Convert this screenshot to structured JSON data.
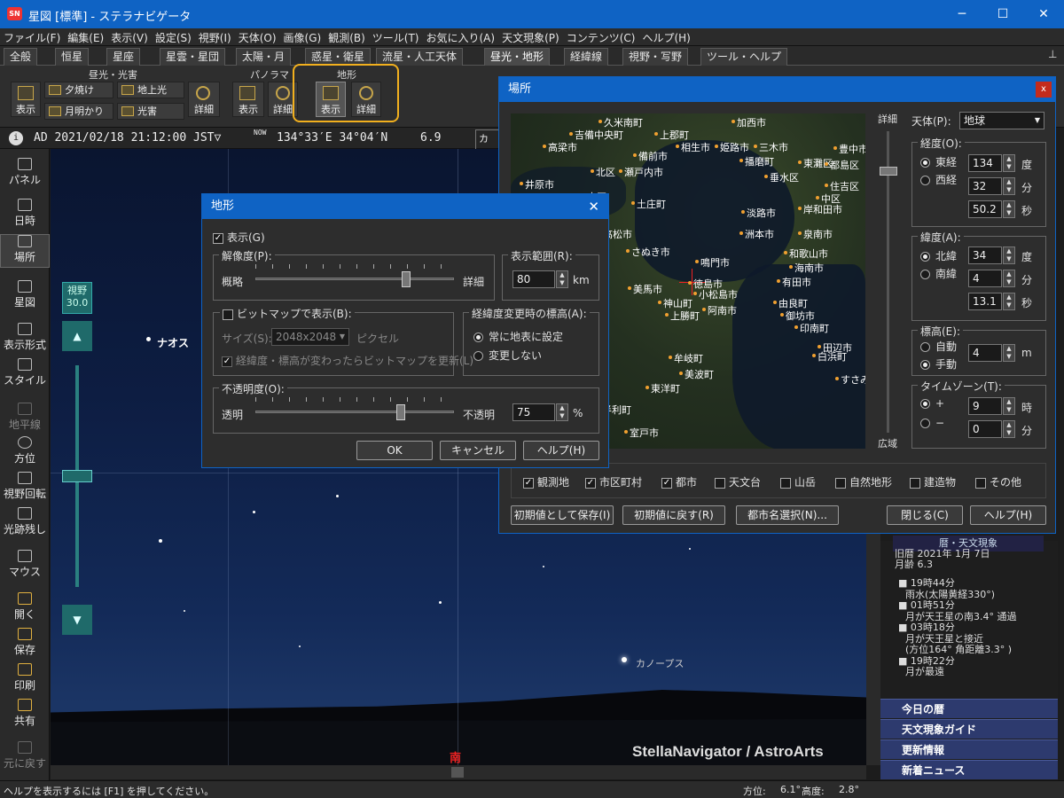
{
  "window": {
    "title": "星図 [標準] - ステラナビゲータ",
    "icon_text": "SN",
    "minimize": "─",
    "maximize": "☐",
    "close": "✕"
  },
  "menu": [
    "ファイル(F)",
    "編集(E)",
    "表示(V)",
    "設定(S)",
    "視野(I)",
    "天体(O)",
    "画像(G)",
    "観測(B)",
    "ツール(T)",
    "お気に入り(A)",
    "天文現象(P)",
    "コンテンツ(C)",
    "ヘルプ(H)"
  ],
  "tabs": [
    "全般",
    "恒星",
    "星座",
    "星雲・星団",
    "太陽・月",
    "惑星・衛星",
    "流星・人工天体",
    "昼光・地形",
    "経緯線",
    "視野・写野",
    "ツール・ヘルプ"
  ],
  "pin": "⊥",
  "ribbon": {
    "group1": "昼光・光害",
    "group2": "パノラマ",
    "group3": "地形",
    "show": "表示",
    "yuyake": "夕焼け",
    "getsumei": "月明かり",
    "chijoko": "地上光",
    "kogai": "光害",
    "detail": "詳細"
  },
  "infobar": {
    "datetime": "AD 2021/02/18 21:12:00 JST▽",
    "now": "NOW",
    "location": "134°33′E 34°04′N",
    "mag": "6.9",
    "mode": "カノ"
  },
  "sidebar": [
    "パネル",
    "日時",
    "場所",
    "星図",
    "表示形式",
    "スタイル",
    "地平線",
    "方位",
    "視野回転",
    "光跡残し",
    "マウス",
    "開く",
    "保存",
    "印刷",
    "共有",
    "元に戻す"
  ],
  "fov": {
    "label": "視野",
    "value": "30.0",
    "up": "▲",
    "down": "▼"
  },
  "sky": {
    "star1": "ナオス",
    "star2": "カノープス",
    "watermark": "StellaNavigator / AstroArts",
    "south": "南"
  },
  "status": {
    "help": "ヘルプを表示するには [F1] を押してください。",
    "azimuth_label": "方位:",
    "azimuth": "6.1°",
    "alt_label": "高度:",
    "alt": "2.8°"
  },
  "rightpanel": {
    "header": "暦・天文現象",
    "kyureki": "旧暦  2021年  1月 7日",
    "getsurei": "月齢  6.3",
    "events": [
      "■ 19時44分",
      "雨水(太陽黄経330°)",
      "■ 01時51分",
      "月が天王星の南3.4° 通過",
      "■ 03時18分",
      "月が天王星と接近",
      "(方位164° 角距離3.3° )",
      "■ 19時22分",
      "月が最遠"
    ],
    "links": [
      "今日の暦",
      "天文現象ガイド",
      "更新情報",
      "新着ニュース"
    ]
  },
  "chikei": {
    "title": "地形",
    "show": "表示(G)",
    "resolution": "解像度(P):",
    "rough": "概略",
    "fine": "詳細",
    "range_label": "表示範囲(R):",
    "range": "80",
    "km": "km",
    "bitmap": "ビットマップで表示(B):",
    "size_label": "サイズ(S):",
    "size": "2048x2048",
    "pixel": "ピクセル",
    "update": "経緯度・標高が変わったらビットマップを更新(L)",
    "elev_label": "経緯度変更時の標高(A):",
    "elev_always": "常に地表に設定",
    "elev_none": "変更しない",
    "opacity_label": "不透明度(O):",
    "transparent": "透明",
    "opaque": "不透明",
    "opacity": "75",
    "percent": "%",
    "ok": "OK",
    "cancel": "キャンセル",
    "help": "ヘルプ(H)"
  },
  "basho": {
    "title": "場所",
    "detail": "詳細",
    "wide": "広域",
    "body_label": "天体(P):",
    "body": "地球",
    "lon_label": "経度(O):",
    "east": "東経",
    "west": "西経",
    "lon_deg": "134",
    "lon_min": "32",
    "lon_sec": "50.2",
    "deg": "度",
    "min": "分",
    "sec": "秒",
    "lat_label": "緯度(A):",
    "north": "北緯",
    "south": "南緯",
    "lat_deg": "34",
    "lat_min": "4",
    "lat_sec": "13.1",
    "alt_label": "標高(E):",
    "auto": "自動",
    "manual": "手動",
    "alt": "4",
    "m": "m",
    "tz_label": "タイムゾーン(T):",
    "plus": "+",
    "minus": "−",
    "tz_h": "9",
    "tz_m": "0",
    "hour": "時",
    "minute": "分",
    "checks": [
      "観測地",
      "市区町村",
      "都市",
      "天文台",
      "山岳",
      "自然地形",
      "建造物",
      "その他"
    ],
    "save_default": "初期値として保存(I)",
    "reset": "初期値に戻す(R)",
    "city_select": "都市名選択(N)...",
    "close": "閉じる(C)",
    "help": "ヘルプ(H)",
    "cities": [
      "久米南町",
      "加西市",
      "吉備中央町",
      "上郡町",
      "高梁市",
      "備前市",
      "相生市",
      "姫路市",
      "三木市",
      "北区",
      "瀬戸内市",
      "播磨町",
      "豊中市",
      "東灘区",
      "都島区",
      "井原市",
      "垂水区",
      "住吉区",
      "中区",
      "南区",
      "土庄町",
      "岸和田市",
      "淡路市",
      "高松市",
      "洲本市",
      "泉南市",
      "さぬき市",
      "鳴門市",
      "和歌山市",
      "海南市",
      "美馬市",
      "徳島市",
      "有田市",
      "小松島市",
      "神山町",
      "阿南市",
      "由良町",
      "上勝町",
      "御坊市",
      "印南町",
      "田辺市",
      "白浜町",
      "牟岐町",
      "美波町",
      "東洋町",
      "室戸市",
      "東洋町",
      "奈半利町",
      "すさみ"
    ]
  }
}
